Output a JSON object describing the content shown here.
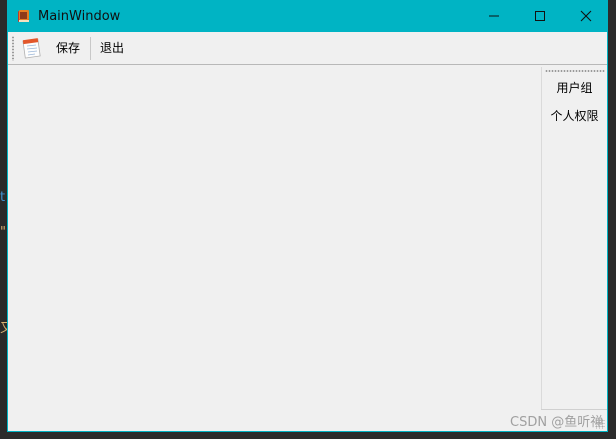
{
  "window": {
    "title": "MainWindow",
    "titlebar_color": "#00b4c4"
  },
  "titlebar": {
    "app_icon": "book-icon",
    "controls": {
      "minimize": "minimize-icon",
      "maximize": "maximize-icon",
      "close": "close-icon"
    }
  },
  "toolbar": {
    "items": [
      {
        "type": "icon",
        "icon": "notepad-icon"
      },
      {
        "type": "text",
        "label": "保存"
      },
      {
        "type": "text",
        "label": "退出"
      }
    ]
  },
  "right_dock": {
    "buttons": [
      {
        "label": "用户组"
      },
      {
        "label": "个人权限"
      }
    ]
  },
  "watermark": {
    "text": "CSDN @鱼听禅"
  },
  "background_editor_fragments": [
    "t",
    "\"",
    "又"
  ]
}
